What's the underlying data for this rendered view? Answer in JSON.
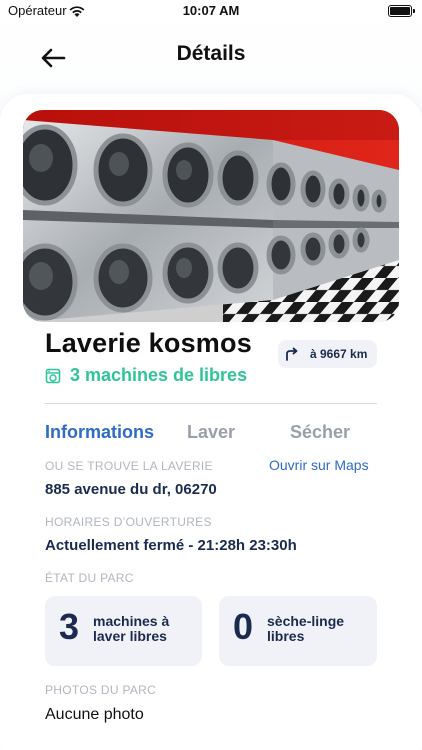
{
  "status_bar": {
    "carrier": "Opérateur",
    "time": "10:07 AM"
  },
  "header": {
    "title": "Détails"
  },
  "laundry": {
    "name": "Laverie kosmos",
    "distance": "à 9667 km",
    "availability": "3 machines de libres"
  },
  "tabs": [
    {
      "label": "Informations",
      "active": true
    },
    {
      "label": "Laver",
      "active": false
    },
    {
      "label": "Sécher",
      "active": false
    }
  ],
  "location": {
    "label": "OU SE TROUVE LA LAVERIE",
    "address": "885 avenue du dr, 06270",
    "maps_link": "Ouvrir sur Maps"
  },
  "hours": {
    "label": "HORAIRES D’OUVERTURES",
    "value": "Actuellement fermé - 21:28h 23:30h"
  },
  "park": {
    "label": "ÉTAT DU PARC",
    "washers": {
      "count": "3",
      "text_line1": "machines à",
      "text_line2": "laver libres"
    },
    "dryers": {
      "count": "0",
      "text_line1": "sèche-linge",
      "text_line2": "libres"
    }
  },
  "photos": {
    "label": "PHOTOS DU PARC",
    "value": "Aucune photo"
  },
  "colors": {
    "accent_blue": "#2e6cc7",
    "green": "#2fc59a",
    "dark_navy": "#1b2b4f",
    "muted": "#b1b6bf"
  }
}
